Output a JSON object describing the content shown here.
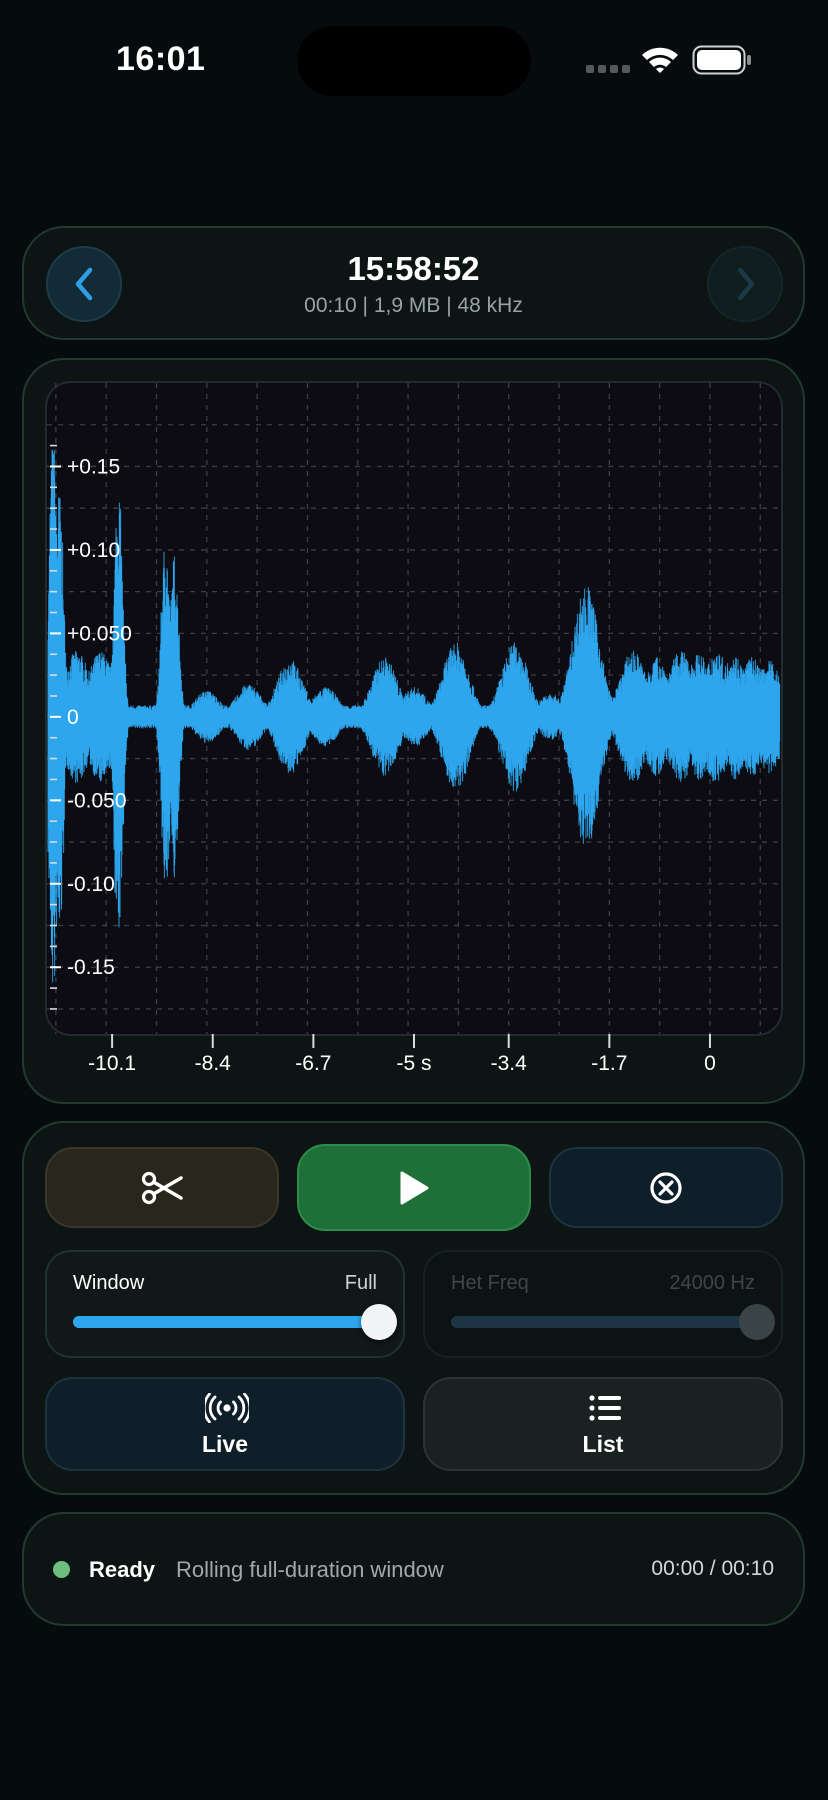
{
  "status_bar": {
    "time": "16:01"
  },
  "recording": {
    "title": "15:58:52",
    "meta": "00:10 | 1,9 MB | 48 kHz"
  },
  "chart_data": {
    "type": "line",
    "title": "",
    "xlabel": "",
    "ylabel": "",
    "x_ticks": [
      "-10.1",
      "-8.4",
      "-6.7",
      "-5 s",
      "-3.4",
      "-1.7",
      "0"
    ],
    "x_tick_values": [
      -10.1,
      -8.4,
      -6.7,
      -5.0,
      -3.4,
      -1.7,
      0
    ],
    "y_ticks": [
      "+0.15",
      "+0.10",
      "+0.050",
      "0",
      "-0.050",
      "-0.10",
      "-0.15"
    ],
    "y_tick_values": [
      0.15,
      0.1,
      0.05,
      0,
      -0.05,
      -0.1,
      -0.15
    ],
    "xlim": [
      -11.2,
      1.2
    ],
    "ylim": [
      -0.19,
      0.2
    ],
    "grid": true,
    "series": [
      {
        "color": "#2ea6ee",
        "bursts": [
          {
            "t": -11.1,
            "amp": 0.17
          },
          {
            "t": -11.0,
            "amp": 0.14
          },
          {
            "t": -10.7,
            "amp": 0.04
          },
          {
            "t": -10.3,
            "amp": 0.04
          },
          {
            "t": -10.0,
            "amp": 0.14
          },
          {
            "t": -9.2,
            "amp": 0.11
          },
          {
            "t": -9.05,
            "amp": 0.1
          },
          {
            "t": -8.5,
            "amp": 0.016
          },
          {
            "t": -7.8,
            "amp": 0.02
          },
          {
            "t": -7.1,
            "amp": 0.035
          },
          {
            "t": -6.5,
            "amp": 0.018
          },
          {
            "t": -5.5,
            "amp": 0.036
          },
          {
            "t": -5.0,
            "amp": 0.018
          },
          {
            "t": -4.3,
            "amp": 0.045
          },
          {
            "t": -3.3,
            "amp": 0.045
          },
          {
            "t": -2.7,
            "amp": 0.014
          },
          {
            "t": -2.1,
            "amp": 0.08
          },
          {
            "t": -1.3,
            "amp": 0.04
          },
          {
            "t": -0.9,
            "amp": 0.036
          },
          {
            "t": -0.5,
            "amp": 0.04
          },
          {
            "t": -0.2,
            "amp": 0.038
          },
          {
            "t": 0.1,
            "amp": 0.04
          },
          {
            "t": 0.4,
            "amp": 0.038
          },
          {
            "t": 0.7,
            "amp": 0.036
          },
          {
            "t": 1.0,
            "amp": 0.034
          }
        ]
      }
    ]
  },
  "controls": {
    "window_label": "Window",
    "window_value": "Full",
    "window_level": 1.0,
    "het_label": "Het Freq",
    "het_value": "24000 Hz",
    "het_level": 1.0,
    "live_label": "Live",
    "list_label": "List"
  },
  "status": {
    "state": "Ready",
    "description": "Rolling full-duration window",
    "time": "00:00 / 00:10",
    "dot_color": "#6ebf7e"
  }
}
